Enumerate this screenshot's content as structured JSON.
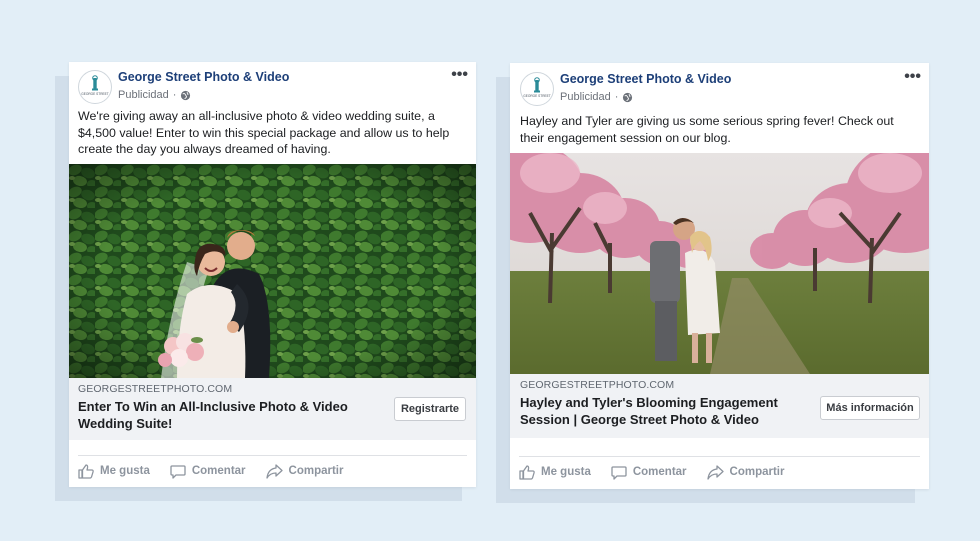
{
  "colors": {
    "background": "#e2eef7",
    "page_name": "#1d3f78",
    "muted": "#8d949e"
  },
  "posts": [
    {
      "page_name": "George Street Photo & Video",
      "logo_text": "GEORGE STREET",
      "sponsored": "Publicidad",
      "text": "We're giving away an all-inclusive photo & video wedding suite, a $4,500 value! Enter to win this special package and allow us to help create the day you always dreamed of having.",
      "domain": "GEORGESTREETPHOTO.COM",
      "link_title": "Enter To Win an All-Inclusive Photo & Video Wedding Suite!",
      "cta": "Registrarte",
      "actions": {
        "like": "Me gusta",
        "comment": "Comentar",
        "share": "Compartir"
      }
    },
    {
      "page_name": "George Street Photo & Video",
      "logo_text": "GEORGE STREET",
      "sponsored": "Publicidad",
      "text": "Hayley and Tyler are giving us some serious spring fever! Check out their engagement session on our blog.",
      "domain": "GEORGESTREETPHOTO.COM",
      "link_title": "Hayley and Tyler's Blooming Engagement Session | George Street Photo & Video",
      "cta": "Más información",
      "actions": {
        "like": "Me gusta",
        "comment": "Comentar",
        "share": "Compartir"
      }
    }
  ]
}
